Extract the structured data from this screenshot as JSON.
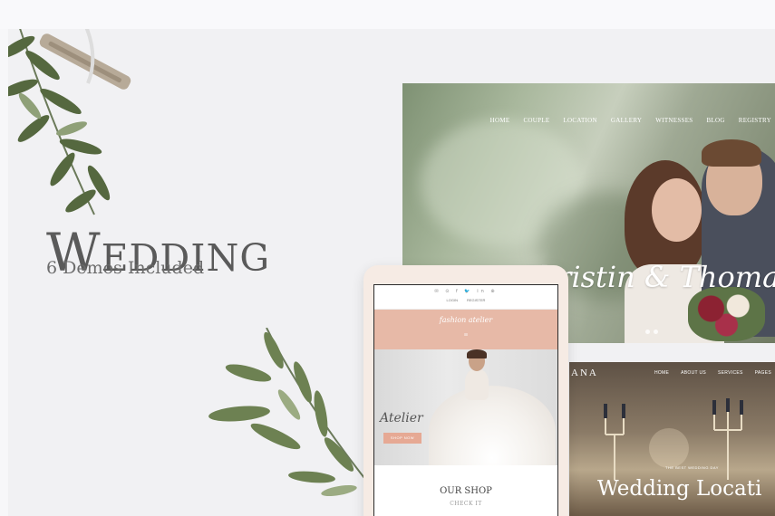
{
  "promo": {
    "title": "Wedding",
    "subtitle": "6 Demos Included"
  },
  "demo_couple": {
    "nav": [
      "HOME",
      "COUPLE",
      "LOCATION",
      "GALLERY",
      "WITNESSES",
      "BLOG",
      "REGISTRY"
    ],
    "names": "Christin & Thomas",
    "prev_arrow": "‹"
  },
  "demo_location": {
    "logo": "ANA",
    "nav": [
      "HOME",
      "ABOUT US",
      "SERVICES",
      "PAGES"
    ],
    "tagline": "THE BEST WEDDING DAY",
    "headline": "Wedding Locati"
  },
  "demo_atelier": {
    "social": "✉ ⊙ f 🐦 in ⊕",
    "login": "LOGIN",
    "register": "REGISTER",
    "logo": "fashion atelier",
    "menu_icon": "≡",
    "hero_script": "Atelier",
    "hero_button": "SHOP NOW",
    "shop_title": "OUR SHOP",
    "shop_link": "CHECK IT"
  },
  "colors": {
    "accent_pink": "#e7b9a7",
    "button_pink": "#e6a994",
    "title_gray": "#5a5a5a"
  },
  "icons": [
    "leaf-branch-icon",
    "leaf-branch-icon",
    "arrow-left-icon",
    "menu-icon"
  ]
}
